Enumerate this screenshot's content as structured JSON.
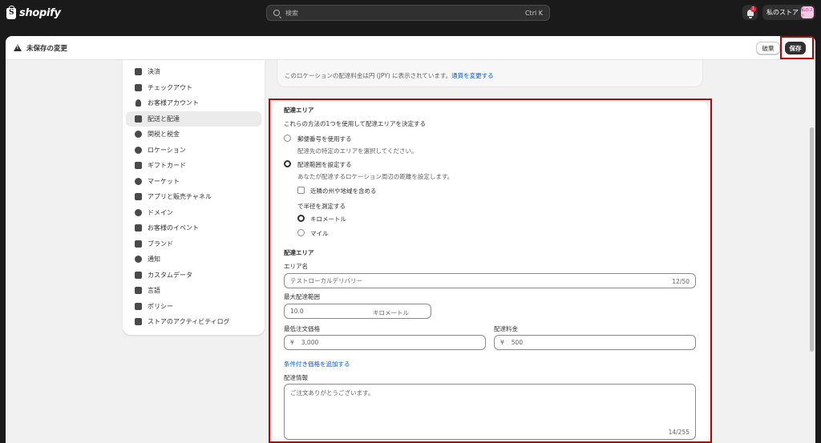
{
  "topbar": {
    "logo_text": "shopify",
    "search_placeholder": "検索",
    "search_shortcut": "Ctrl K",
    "notification_count": "1",
    "store_name": "私のストア",
    "store_avatar": "私のスト"
  },
  "unsaved_bar": {
    "title": "未保存の変更",
    "discard_label": "破棄",
    "save_label": "保存"
  },
  "sidebar": {
    "items": [
      {
        "label": "決済",
        "icon": "payment-icon"
      },
      {
        "label": "チェックアウト",
        "icon": "cart-icon"
      },
      {
        "label": "お客様アカウント",
        "icon": "person-icon"
      },
      {
        "label": "配送と配達",
        "icon": "truck-icon",
        "active": true
      },
      {
        "label": "関税と税金",
        "icon": "money-bag-icon"
      },
      {
        "label": "ロケーション",
        "icon": "location-pin-icon"
      },
      {
        "label": "ギフトカード",
        "icon": "gift-card-icon"
      },
      {
        "label": "マーケット",
        "icon": "globe-icon"
      },
      {
        "label": "アプリと販売チャネル",
        "icon": "apps-icon"
      },
      {
        "label": "ドメイン",
        "icon": "globe-icon"
      },
      {
        "label": "お客様のイベント",
        "icon": "sparkle-icon"
      },
      {
        "label": "ブランド",
        "icon": "brand-icon"
      },
      {
        "label": "通知",
        "icon": "bell-icon"
      },
      {
        "label": "カスタムデータ",
        "icon": "data-icon"
      },
      {
        "label": "言語",
        "icon": "language-icon"
      },
      {
        "label": "ポリシー",
        "icon": "policy-icon"
      },
      {
        "label": "ストアのアクティビティログ",
        "icon": "list-icon"
      }
    ]
  },
  "info": {
    "text": "このロケーションの配達料金は円 (JPY) に表示されています。",
    "link": "通貨を変更する"
  },
  "delivery_zone": {
    "title": "配達エリア",
    "description": "これらの方法の1つを使用して配達エリアを決定する",
    "option_postal": "郵便番号を使用する",
    "option_postal_desc": "配達先の特定のエリアを選択してください。",
    "option_radius": "配達範囲を設定する",
    "option_radius_desc": "あなたが配達するロケーション周辺の距離を設定します。",
    "include_neighbors": "近隣の州や地域を含める",
    "measure_label": "で半径を測定する",
    "unit_km": "キロメートル",
    "unit_mile": "マイル"
  },
  "zone_details": {
    "title": "配達エリア",
    "area_name_label": "エリア名",
    "area_name_value": "テストローカルデリバリー",
    "area_name_counter": "12/50",
    "max_range_label": "最大配達範囲",
    "max_range_value": "10.0",
    "max_range_unit": "キロメートル",
    "min_order_label": "最低注文価格",
    "min_order_currency": "¥",
    "min_order_value": "3,000",
    "fee_label": "配達料金",
    "fee_currency": "¥",
    "fee_value": "500",
    "add_conditional": "条件付き価格を追加する",
    "info_label": "配達情報",
    "info_value": "ご注文ありがとうございます。",
    "info_counter": "14/255"
  }
}
